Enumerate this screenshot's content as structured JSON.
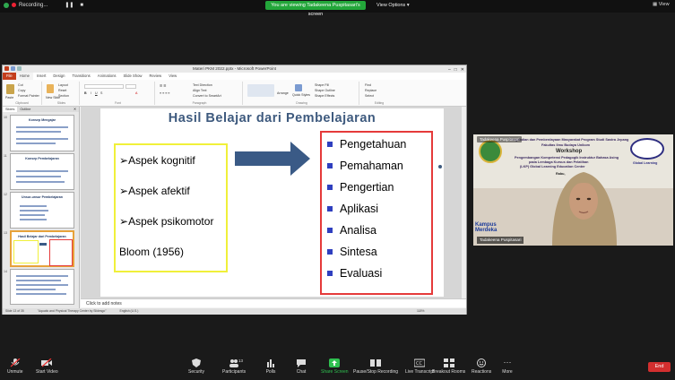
{
  "top_bar": {
    "recording_label": "Recording...",
    "viewing_banner": "You are viewing Tadakeena Puspitasari's screen",
    "view_options_label": "View Options",
    "view_label": "View"
  },
  "ppt": {
    "window_title": "Materi PKM 2022.pptx - Microsoft PowerPoint",
    "tabs": [
      "File",
      "Home",
      "Insert",
      "Design",
      "Transitions",
      "Animations",
      "Slide Show",
      "Review",
      "View"
    ],
    "ribbon": {
      "cut": "Cut",
      "copy": "Copy",
      "format_painter": "Format Painter",
      "paste": "Paste",
      "new_slide": "New Slide",
      "layout": "Layout",
      "reset": "Reset",
      "section": "Section",
      "text_direction": "Text Direction",
      "align_text": "Align Text",
      "convert_smartart": "Convert to SmartArt",
      "arrange": "Arrange",
      "quick_styles": "Quick Styles",
      "shape_fill": "Shape Fill",
      "shape_outline": "Shape Outline",
      "shape_effects": "Shape Effects",
      "find": "Find",
      "replace": "Replace",
      "select": "Select",
      "groups": [
        "Clipboard",
        "Slides",
        "Font",
        "Paragraph",
        "Drawing",
        "Editing"
      ]
    },
    "pane_tabs": [
      "Slides",
      "Outline"
    ],
    "thumbnails": [
      {
        "num": "10",
        "title": "Konsep Mengajar"
      },
      {
        "num": "11",
        "title": "Konsep Pembelajaran"
      },
      {
        "num": "12",
        "title": "Unsur-unsur Pembelajaran"
      },
      {
        "num": "13",
        "title": "Hasil Belajar dari Pembelajaran"
      },
      {
        "num": "14",
        "title": ""
      }
    ],
    "slide": {
      "title": "Hasil Belajar dari Pembelajaran",
      "left_items": [
        "Aspek kognitif",
        "Aspek afektif",
        "Aspek psikomotor"
      ],
      "bloom": "Bloom (1956)",
      "right_items": [
        "Pengetahuan",
        "Pemahaman",
        "Pengertian",
        "Aplikasi",
        "Analisa",
        "Sintesa",
        "Evaluasi"
      ]
    },
    "notes_placeholder": "Click to add notes",
    "status": {
      "slide_info": "Slide 13 of 35",
      "theme": "\"Aquatic and Physical Therapy Center by Slidesgo\"",
      "language": "English (U.S.)",
      "zoom": "118%"
    }
  },
  "video": {
    "participant_name": "Tadakeena Puspitasari",
    "banner_lines": [
      "Pengabdian dan Pemberdayaan Masyarakat Program Studi Sastra Jepang",
      "Fakultas Ilmu Budaya Unikom",
      "Workshop",
      "Pengembangan Kompetensi Pedagogik Instruktur Bahasa Asing",
      "pada Lembaga Kursus dan Pelatihan",
      "(LKP) Global Learning Education Center",
      "Rabu,"
    ],
    "logo_right_text": "Global Learning",
    "kampus_merdeka": "Kampus\nMerdeka"
  },
  "toolbar": {
    "unmute": "Unmute",
    "start_video": "Start Video",
    "security": "Security",
    "participants": "Participants",
    "participants_count": "13",
    "polls": "Polls",
    "chat": "Chat",
    "share_screen": "Share Screen",
    "pause_recording": "Pause/Stop Recording",
    "live_transcript": "Live Transcript",
    "breakout_rooms": "Breakout Rooms",
    "reactions": "Reactions",
    "more": "More",
    "end": "End"
  },
  "colors": {
    "zoom_green": "#23a63a",
    "end_red": "#d32f2f",
    "slide_title": "#3e5a7e",
    "left_box_border": "#f0f03a",
    "right_box_border": "#e53a3a",
    "bullet": "#2f3fbf",
    "arrow": "#3a5a86"
  }
}
